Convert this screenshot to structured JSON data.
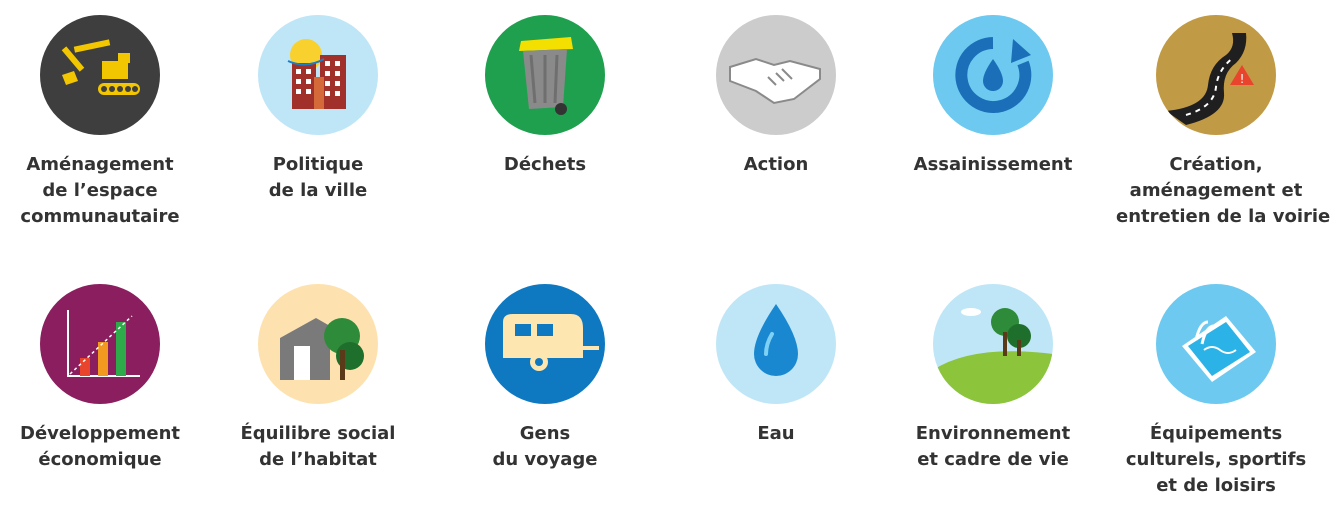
{
  "items": [
    {
      "icon": "excavator-icon",
      "bg": "#3e3e3e",
      "lines": [
        "Aménagement",
        "de l’espace",
        "communautaire"
      ]
    },
    {
      "icon": "city-buildings-icon",
      "bg": "#bfe6f7",
      "lines": [
        "Politique",
        "de la ville"
      ]
    },
    {
      "icon": "trash-bin-icon",
      "bg": "#1fa04f",
      "lines": [
        "Déchets"
      ]
    },
    {
      "icon": "handshake-icon",
      "bg": "#cccccc",
      "lines": [
        "Action"
      ]
    },
    {
      "icon": "water-cycle-icon",
      "bg": "#6dc9ef",
      "lines": [
        "Assainissement"
      ]
    },
    {
      "icon": "road-icon",
      "bg": "#c19a45",
      "lines": [
        "Création,",
        "aménagement et",
        "entretien de la voirie"
      ]
    },
    {
      "icon": "bar-chart-icon",
      "bg": "#8a1e5e",
      "lines": [
        "Développement",
        "économique"
      ]
    },
    {
      "icon": "house-tree-icon",
      "bg": "#fde2b0",
      "lines": [
        "Équilibre social",
        "de l’habitat"
      ]
    },
    {
      "icon": "caravan-icon",
      "bg": "#0e79c1",
      "lines": [
        "Gens",
        "du voyage"
      ]
    },
    {
      "icon": "water-drop-icon",
      "bg": "#bfe6f7",
      "lines": [
        "Eau"
      ]
    },
    {
      "icon": "landscape-tree-icon",
      "bg": "#bfe6f7",
      "lines": [
        "Environnement",
        "et cadre de vie"
      ]
    },
    {
      "icon": "swimming-pool-icon",
      "bg": "#6dc9ef",
      "lines": [
        "Équipements",
        "culturels, sportifs",
        "et de loisirs"
      ]
    }
  ]
}
